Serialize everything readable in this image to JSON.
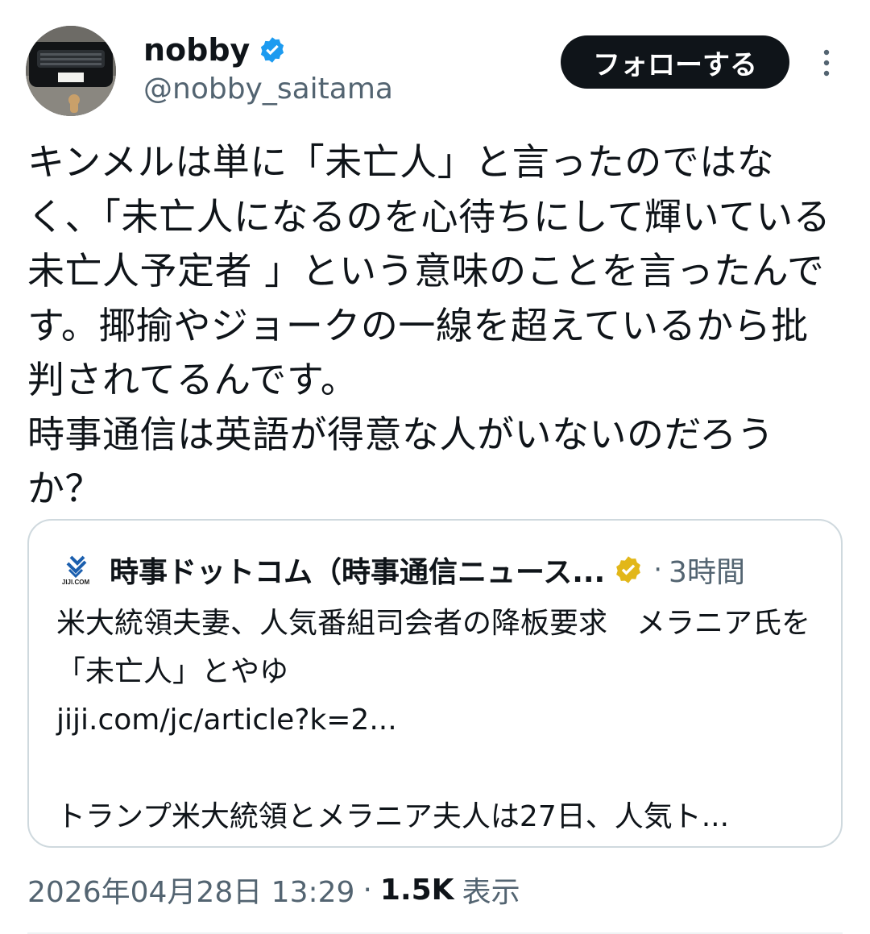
{
  "author": {
    "display_name": "nobby",
    "handle": "@nobby_saitama",
    "verified": true,
    "verified_color": "#1d9bf0"
  },
  "follow_button": {
    "label": "フォローする"
  },
  "more_icon": "more-vertical-icon",
  "tweet": {
    "text": "キンメルは単に「未亡人」と言ったのではなく、「未亡人になるのを心待ちにして輝いている未亡人予定者 」という意味のことを言ったんです。揶揄やジョークの一線を超えているから批判されてるんです。\n時事通信は英語が得意な人がいないのだろうか？"
  },
  "quote": {
    "logo_text": "JIJI.COM",
    "account_name": "時事ドットコム（時事通信ニュース...",
    "badge_color": "#e2b719",
    "separator": "·",
    "time": "3時間",
    "headline": "米大統領夫妻、人気番組司会者の降板要求　メラニア氏を「未亡人」とやゆ",
    "link": "jiji.com/jc/article?k=2...",
    "excerpt": "トランプ米大統領とメラニア夫人は27日、人気ト..."
  },
  "meta": {
    "timestamp": "2026年04月28日 13:29",
    "separator": "·",
    "views": "1.5K",
    "views_label": "表示"
  }
}
